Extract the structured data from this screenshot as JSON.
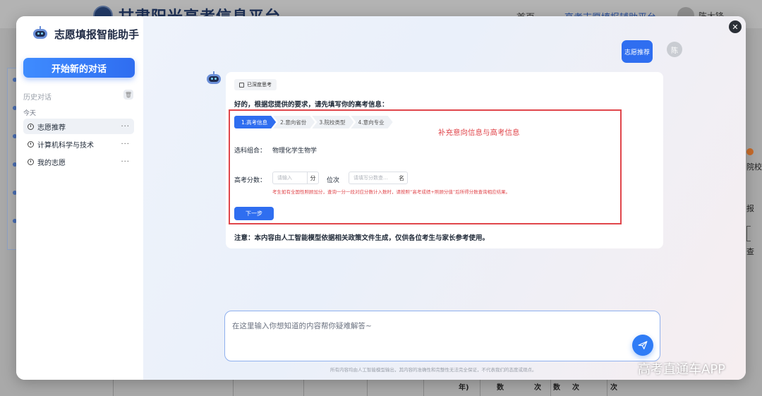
{
  "background_page": {
    "site_title": "甘肃阳光高考信息平台",
    "nav_home": "首页",
    "nav_assist": "高考志愿填报辅助平台",
    "user_name": "陈大锋",
    "right_text_1": "院校",
    "right_text_2": "报",
    "right_text_3": "查",
    "table_cells": [
      "年)",
      "数",
      "次",
      "数",
      "次",
      "次"
    ]
  },
  "sidebar": {
    "brand_name": "志愿填报智能助手",
    "new_chat_label": "开始新的对话",
    "history_label": "历史对话",
    "today_label": "今天",
    "items": [
      {
        "label": "志愿推荐",
        "more": "···"
      },
      {
        "label": "计算机科学与技术",
        "more": "···"
      },
      {
        "label": "我的志愿",
        "more": "···"
      }
    ]
  },
  "chat": {
    "close_symbol": "✕",
    "user_message": "志愿推荐",
    "user_avatar_text": "陈",
    "deep_think_tag": "已深度思考",
    "intro_text": "好的，根据您提供的要求，请先填写你的高考信息：",
    "steps": [
      "1.高考信息",
      "2.意向省份",
      "3.院校类型",
      "4.意向专业"
    ],
    "annotation": "补充意向信息与高考信息",
    "subject_label": "选科组合：",
    "subject_value": "物理化学生物学",
    "score_label": "高考分数：",
    "score_placeholder": "请输入",
    "score_unit": "分",
    "rank_label": "位次",
    "rank_placeholder": "请填写分数查…",
    "rank_unit": "名",
    "hint": "考生如有全国性照顾加分，查询一分一段对应分数计入数时，请按照“高考成绩+照顾分值”后所得分数查询相应结果。",
    "next_button": "下一步",
    "note": "注意：本内容由人工智能模型依据相关政策文件生成，仅供各位考生与家长参考使用。"
  },
  "input": {
    "placeholder": "在这里输入你想知道的内容帮你疑难解答~",
    "footer": "所有内容均由人工智能模型输出，其内容的准确性和完整性无法完全保证，不代表我们的态度或观点。"
  },
  "watermark": "高考直通车APP",
  "colors": {
    "primary": "#2f6ef0",
    "annotation_red": "#e0464b"
  }
}
